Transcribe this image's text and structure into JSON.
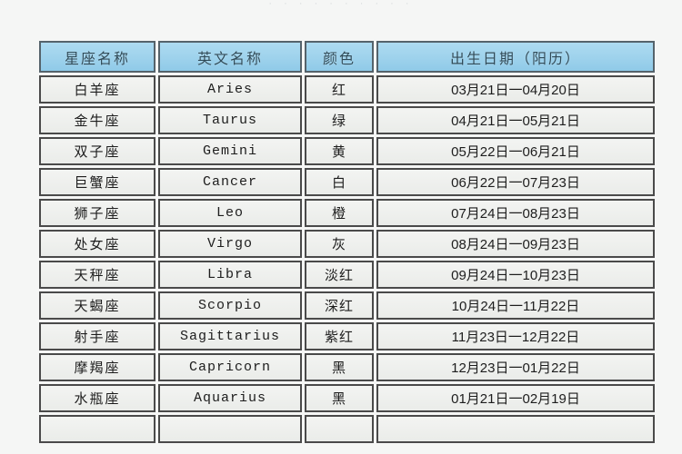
{
  "page": {
    "top_strip_text": "· · · · ·   · ·   · · ·",
    "background_color": "#f5f6f5"
  },
  "table": {
    "header_color": "#a3d6ef",
    "cell_color": "#eef0ee",
    "border_color": "#4a4a4a",
    "columns": [
      {
        "key": "name",
        "label": "星座名称"
      },
      {
        "key": "en",
        "label": "英文名称"
      },
      {
        "key": "color",
        "label": "颜色"
      },
      {
        "key": "date",
        "label": "出生日期（阳历）"
      }
    ],
    "rows": [
      {
        "name": "白羊座",
        "en": "Aries",
        "color": "红",
        "date": "03月21日一04月20日"
      },
      {
        "name": "金牛座",
        "en": "Taurus",
        "color": "绿",
        "date": "04月21日一05月21日"
      },
      {
        "name": "双子座",
        "en": "Gemini",
        "color": "黄",
        "date": "05月22日一06月21日"
      },
      {
        "name": "巨蟹座",
        "en": "Cancer",
        "color": "白",
        "date": "06月22日一07月23日"
      },
      {
        "name": "狮子座",
        "en": "Leo",
        "color": "橙",
        "date": "07月24日一08月23日"
      },
      {
        "name": "处女座",
        "en": "Virgo",
        "color": "灰",
        "date": "08月24日一09月23日"
      },
      {
        "name": "天秤座",
        "en": "Libra",
        "color": "淡红",
        "date": "09月24日一10月23日"
      },
      {
        "name": "天蝎座",
        "en": "Scorpio",
        "color": "深红",
        "date": "10月24日一11月22日"
      },
      {
        "name": "射手座",
        "en": "Sagittarius",
        "color": "紫红",
        "date": "11月23日一12月22日"
      },
      {
        "name": "摩羯座",
        "en": "Capricorn",
        "color": "黑",
        "date": "12月23日一01月22日"
      },
      {
        "name": "水瓶座",
        "en": "Aquarius",
        "color": "黑",
        "date": "01月21日一02月19日"
      }
    ]
  }
}
